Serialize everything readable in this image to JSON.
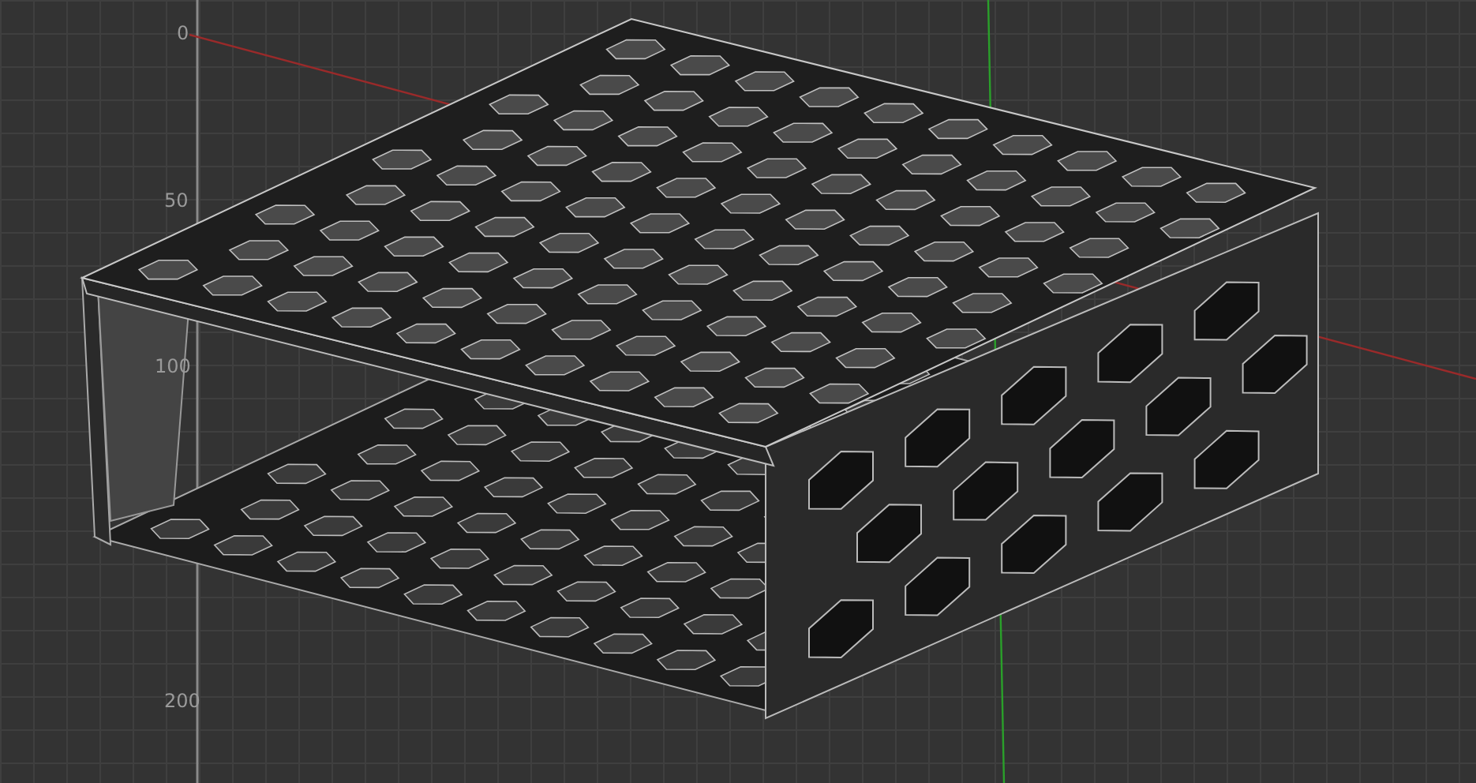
{
  "viewport": {
    "ruler_labels": [
      {
        "text": "0"
      },
      {
        "text": "50"
      },
      {
        "text": "100"
      },
      {
        "text": "200"
      }
    ]
  }
}
